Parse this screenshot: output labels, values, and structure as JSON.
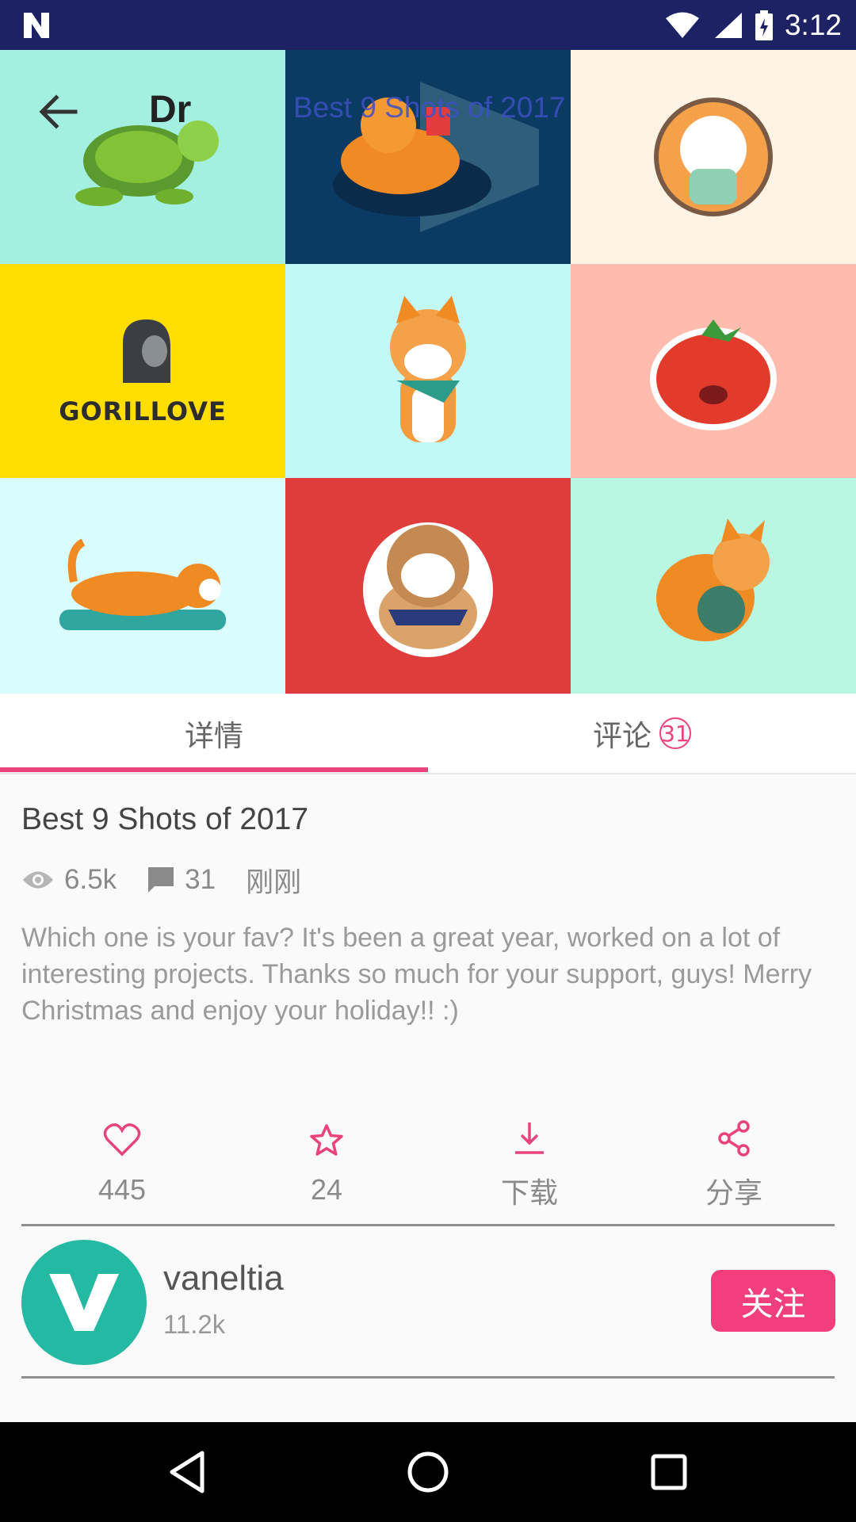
{
  "status_bar": {
    "time": "3:12"
  },
  "toolbar": {
    "app_title": "Dr",
    "shot_title_overlay": "Best 9 Shots of 2017"
  },
  "grid": {
    "tiles": [
      {
        "name": "turtle",
        "bg": "#a3f0e0"
      },
      {
        "name": "cat-popcorn",
        "bg": "#0b3b63"
      },
      {
        "name": "beagle-badge",
        "bg": "#fff3e6"
      },
      {
        "name": "gorillove",
        "bg": "#ffde00",
        "logo_text": "GORILLOVE"
      },
      {
        "name": "shiba",
        "bg": "#c2f8f5"
      },
      {
        "name": "tomato",
        "bg": "#ffbcae"
      },
      {
        "name": "sleeping-dog",
        "bg": "#d8fdfc"
      },
      {
        "name": "bulldog",
        "bg": "#e03c3c"
      },
      {
        "name": "cat-yarn",
        "bg": "#b8f8e2"
      }
    ]
  },
  "tabs": {
    "details": "详情",
    "comments": "评论",
    "comments_count": "31"
  },
  "shot": {
    "title": "Best 9 Shots of 2017",
    "views": "6.5k",
    "comments": "31",
    "time": "刚刚",
    "description": "Which one is your fav? It's been a great year, worked on a lot of interesting projects. Thanks so much for your support, guys! Merry Christmas and enjoy your holiday!! :)"
  },
  "actions": {
    "likes": "445",
    "stars": "24",
    "download": "下载",
    "share": "分享"
  },
  "author": {
    "name": "vaneltia",
    "followers": "11.2k",
    "avatar_letter": "V",
    "follow_label": "关注"
  },
  "colors": {
    "accent": "#e8437a",
    "status_bar": "#1d2264",
    "avatar": "#23b9a3",
    "follow": "#f13f7e"
  }
}
